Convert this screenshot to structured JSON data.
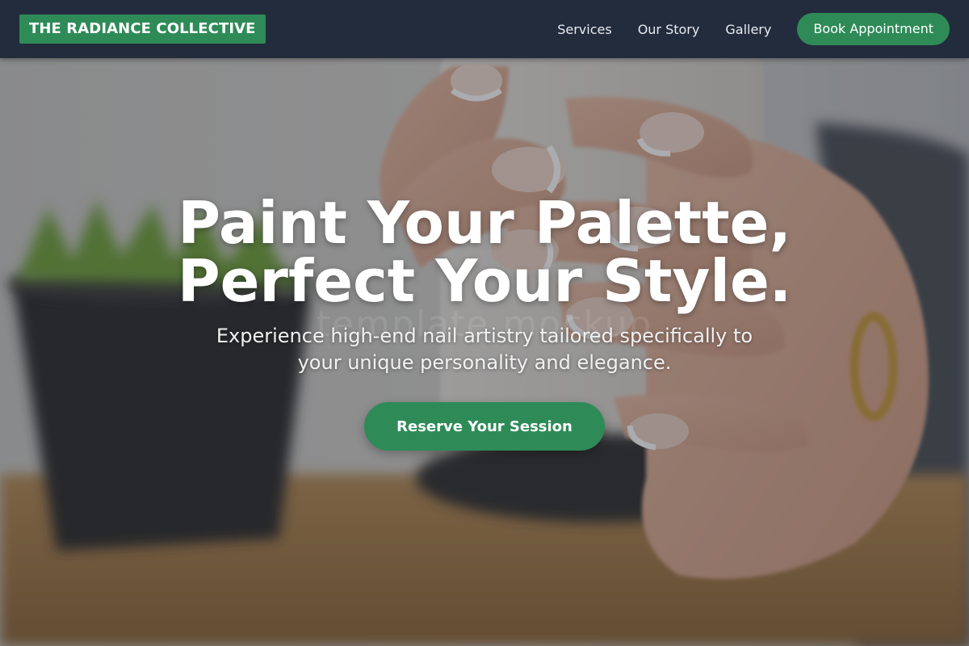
{
  "brand": {
    "name": "THE RADIANCE COLLECTIVE",
    "accent": "#2e8b57",
    "header_bg": "#232c3d"
  },
  "nav": {
    "links": [
      "Services",
      "Our Story",
      "Gallery"
    ],
    "cta": "Book Appointment"
  },
  "hero": {
    "title_line1": "Paint Your Palette,",
    "title_line2": "Perfect Your Style.",
    "subtitle": "Experience high-end nail artistry tailored specifically to your unique personality and elegance.",
    "cta": "Reserve Your Session",
    "watermark": "template mockup",
    "image": "hands-with-french-manicure-holding-mug-photo"
  }
}
